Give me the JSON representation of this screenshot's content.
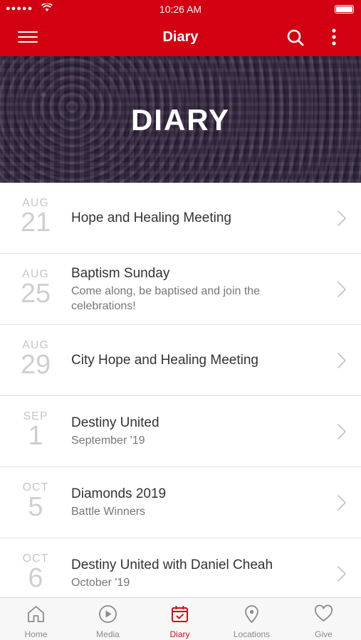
{
  "status_bar": {
    "signal": "●●●●●",
    "time": "10:26 AM"
  },
  "nav": {
    "title": "Diary"
  },
  "banner": {
    "title": "DIARY"
  },
  "events": [
    {
      "month": "AUG",
      "day": "21",
      "title": "Hope and Healing Meeting",
      "subtitle": ""
    },
    {
      "month": "AUG",
      "day": "25",
      "title": "Baptism Sunday",
      "subtitle": "Come along, be baptised and join the celebrations!"
    },
    {
      "month": "AUG",
      "day": "29",
      "title": "City Hope and Healing Meeting",
      "subtitle": ""
    },
    {
      "month": "SEP",
      "day": "1",
      "title": "Destiny United",
      "subtitle": "September '19"
    },
    {
      "month": "OCT",
      "day": "5",
      "title": "Diamonds 2019",
      "subtitle": "Battle Winners"
    },
    {
      "month": "OCT",
      "day": "6",
      "title": "Destiny United with Daniel Cheah",
      "subtitle": "October '19"
    }
  ],
  "tabs": [
    {
      "label": "Home",
      "icon": "home-icon"
    },
    {
      "label": "Media",
      "icon": "play-icon"
    },
    {
      "label": "Diary",
      "icon": "calendar-icon"
    },
    {
      "label": "Locations",
      "icon": "location-pin-icon"
    },
    {
      "label": "Give",
      "icon": "heart-icon"
    }
  ],
  "colors": {
    "brand": "#d20011",
    "active_tab": "#c8101e"
  }
}
